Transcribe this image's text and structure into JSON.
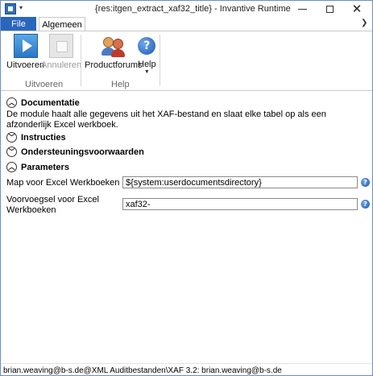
{
  "window": {
    "title": "{res:itgen_extract_xaf32_title} - Invantive Runtime"
  },
  "tabs": {
    "file": "File",
    "algemeen": "Algemeen"
  },
  "ribbon": {
    "uitvoeren_label": "Uitvoeren",
    "annuleren_label": "Annuleren",
    "productforums_label": "Productforums",
    "help_label": "Help",
    "group_uitvoeren": "Uitvoeren",
    "group_help": "Help"
  },
  "sections": {
    "documentatie": {
      "title": "Documentatie",
      "expanded": true,
      "text": "De module haalt alle gegevens uit het XAF-bestand en slaat elke tabel op als een afzonderlijk Excel werkboek."
    },
    "instructies": {
      "title": "Instructies",
      "expanded": false
    },
    "ondersteuningsvoorwaarden": {
      "title": "Ondersteuningsvoorwaarden",
      "expanded": false
    },
    "parameters": {
      "title": "Parameters",
      "expanded": true,
      "items": [
        {
          "label": "Map voor Excel Werkboeken",
          "value": "${system:userdocumentsdirectory}"
        },
        {
          "label": "Voorvoegsel voor Excel Werkboeken",
          "value": "xaf32-"
        }
      ]
    }
  },
  "statusbar": {
    "text": "brian.weaving@b-s.de@XML Auditbestanden\\XAF 3.2: brian.weaving@b-s.de"
  },
  "icons": {
    "uitvoeren": "play-icon",
    "annuleren": "stop-icon",
    "productforums": "users-icon",
    "help": "help-icon"
  }
}
